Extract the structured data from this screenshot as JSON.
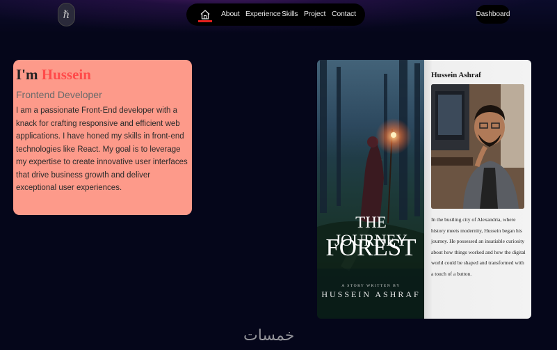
{
  "header": {
    "logo_text": "ℏ",
    "nav": {
      "home_icon": "home-icon",
      "links": [
        "About",
        "Experience",
        "Skills",
        "Project",
        "Contact"
      ]
    },
    "dashboard_label": "Dashboard"
  },
  "intro": {
    "greeting": "I'm ",
    "name": "Hussein",
    "role": "Frontend Developer",
    "bio": "I am a passionate Front-End developer with a knack for crafting responsive and efficient web applications. I have honed my skills in front-end technologies like React. My goal is to leverage my expertise to create innovative user interfaces that drive business growth and deliver exceptional user experiences."
  },
  "book": {
    "cover_title_line1": "THE JOURNEY",
    "cover_title_line2": "FOREST",
    "cover_byline": "A STORY WRITTEN BY",
    "cover_author": "HUSSEIN ASHRAF",
    "page_heading": "Hussein Ashraf",
    "page_text": "In the bustling city of Alexandria, where history meets modernity, Hussein began his journey. He possessed an insatiable curiosity about how things worked and how the digital world could be shaped and transformed with a touch of a button."
  },
  "watermark": "خمسات",
  "colors": {
    "background": "#05061a",
    "accent_red": "#e0201e",
    "intro_card": "#fd9a8a",
    "name_color": "#ff4a4a"
  }
}
